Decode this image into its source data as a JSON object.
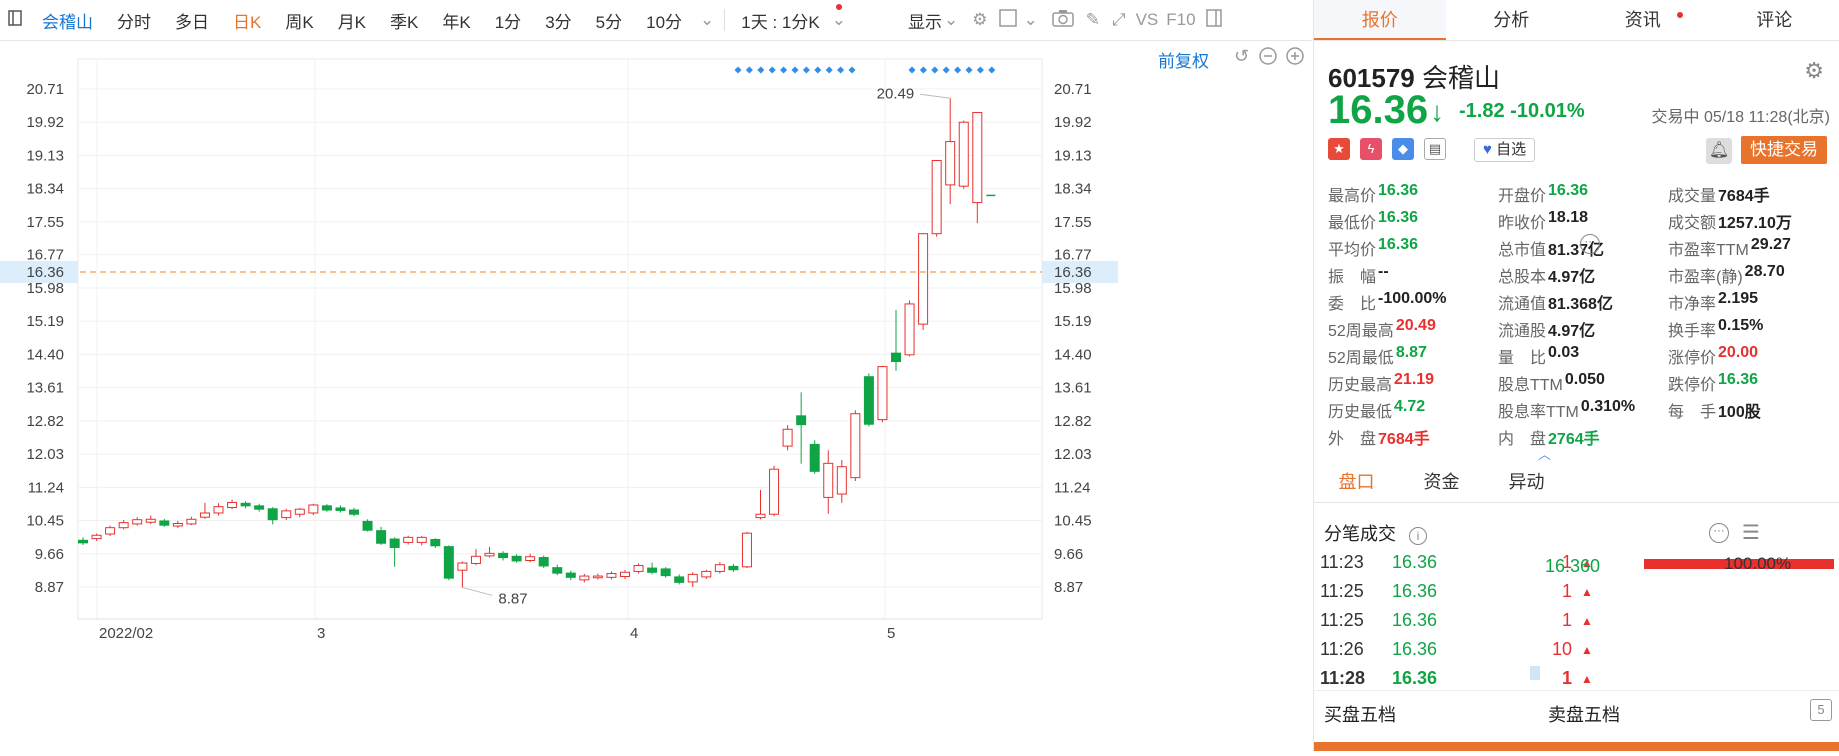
{
  "toolbar": {
    "stock_name": "会稽山",
    "periods": [
      "分时",
      "多日",
      "日K",
      "周K",
      "月K",
      "季K",
      "年K",
      "1分",
      "3分",
      "5分",
      "10分"
    ],
    "active_period": "日K",
    "interval_select": "1天 : 1分K",
    "display_label": "显示",
    "vs_label": "VS",
    "f10_label": "F10"
  },
  "chart_controls": {
    "adjust_label": "前复权"
  },
  "chart_data": {
    "type": "candlestick",
    "y_ticks": [
      "20.71",
      "19.92",
      "19.13",
      "18.34",
      "17.55",
      "16.77",
      "15.98",
      "15.19",
      "14.40",
      "13.61",
      "12.82",
      "12.03",
      "11.24",
      "10.45",
      "9.66",
      "8.87"
    ],
    "ylim": [
      8.87,
      20.71
    ],
    "x_labels": [
      "2022/02",
      "3",
      "4",
      "5"
    ],
    "current_price_line": "16.36",
    "high_annotation": "20.49",
    "low_annotation": "8.87",
    "up_color": "#e8302f",
    "down_color": "#0fa546",
    "candles": [
      {
        "o": 9.98,
        "c": 9.92,
        "h": 10.05,
        "l": 9.87
      },
      {
        "o": 10.02,
        "c": 10.1,
        "h": 10.14,
        "l": 9.97
      },
      {
        "o": 10.13,
        "c": 10.28,
        "h": 10.33,
        "l": 10.08
      },
      {
        "o": 10.28,
        "c": 10.4,
        "h": 10.46,
        "l": 10.24
      },
      {
        "o": 10.37,
        "c": 10.47,
        "h": 10.53,
        "l": 10.33
      },
      {
        "o": 10.41,
        "c": 10.48,
        "h": 10.57,
        "l": 10.36
      },
      {
        "o": 10.44,
        "c": 10.34,
        "h": 10.49,
        "l": 10.3
      },
      {
        "o": 10.32,
        "c": 10.38,
        "h": 10.44,
        "l": 10.27
      },
      {
        "o": 10.37,
        "c": 10.48,
        "h": 10.54,
        "l": 10.34
      },
      {
        "o": 10.53,
        "c": 10.63,
        "h": 10.87,
        "l": 10.49
      },
      {
        "o": 10.63,
        "c": 10.78,
        "h": 10.86,
        "l": 10.57
      },
      {
        "o": 10.76,
        "c": 10.88,
        "h": 10.95,
        "l": 10.72
      },
      {
        "o": 10.86,
        "c": 10.8,
        "h": 10.91,
        "l": 10.74
      },
      {
        "o": 10.8,
        "c": 10.72,
        "h": 10.85,
        "l": 10.66
      },
      {
        "o": 10.73,
        "c": 10.47,
        "h": 10.77,
        "l": 10.36
      },
      {
        "o": 10.52,
        "c": 10.68,
        "h": 10.73,
        "l": 10.46
      },
      {
        "o": 10.6,
        "c": 10.72,
        "h": 10.75,
        "l": 10.53
      },
      {
        "o": 10.63,
        "c": 10.82,
        "h": 10.85,
        "l": 10.58
      },
      {
        "o": 10.8,
        "c": 10.7,
        "h": 10.84,
        "l": 10.66
      },
      {
        "o": 10.75,
        "c": 10.69,
        "h": 10.81,
        "l": 10.64
      },
      {
        "o": 10.7,
        "c": 10.6,
        "h": 10.75,
        "l": 10.55
      },
      {
        "o": 10.43,
        "c": 10.22,
        "h": 10.48,
        "l": 10.19
      },
      {
        "o": 10.21,
        "c": 9.91,
        "h": 10.3,
        "l": 9.87
      },
      {
        "o": 10.01,
        "c": 9.81,
        "h": 10.05,
        "l": 9.35
      },
      {
        "o": 9.93,
        "c": 10.05,
        "h": 10.09,
        "l": 9.88
      },
      {
        "o": 9.93,
        "c": 10.05,
        "h": 10.08,
        "l": 9.86
      },
      {
        "o": 10.0,
        "c": 9.85,
        "h": 10.03,
        "l": 9.8
      },
      {
        "o": 9.83,
        "c": 9.08,
        "h": 9.86,
        "l": 9.03
      },
      {
        "o": 9.27,
        "c": 9.44,
        "h": 9.48,
        "l": 8.86
      },
      {
        "o": 9.43,
        "c": 9.6,
        "h": 9.77,
        "l": 9.39
      },
      {
        "o": 9.61,
        "c": 9.67,
        "h": 9.82,
        "l": 9.57
      },
      {
        "o": 9.67,
        "c": 9.57,
        "h": 9.72,
        "l": 9.5
      },
      {
        "o": 9.6,
        "c": 9.49,
        "h": 9.65,
        "l": 9.45
      },
      {
        "o": 9.5,
        "c": 9.59,
        "h": 9.66,
        "l": 9.46
      },
      {
        "o": 9.57,
        "c": 9.37,
        "h": 9.62,
        "l": 9.32
      },
      {
        "o": 9.33,
        "c": 9.2,
        "h": 9.4,
        "l": 9.15
      },
      {
        "o": 9.2,
        "c": 9.1,
        "h": 9.26,
        "l": 9.03
      },
      {
        "o": 9.04,
        "c": 9.13,
        "h": 9.18,
        "l": 8.98
      },
      {
        "o": 9.09,
        "c": 9.13,
        "h": 9.19,
        "l": 9.05
      },
      {
        "o": 9.1,
        "c": 9.19,
        "h": 9.24,
        "l": 9.05
      },
      {
        "o": 9.12,
        "c": 9.22,
        "h": 9.27,
        "l": 9.06
      },
      {
        "o": 9.24,
        "c": 9.38,
        "h": 9.43,
        "l": 9.19
      },
      {
        "o": 9.32,
        "c": 9.22,
        "h": 9.45,
        "l": 9.17
      },
      {
        "o": 9.3,
        "c": 9.14,
        "h": 9.34,
        "l": 9.09
      },
      {
        "o": 9.11,
        "c": 8.98,
        "h": 9.17,
        "l": 8.93
      },
      {
        "o": 8.99,
        "c": 9.17,
        "h": 9.22,
        "l": 8.87
      },
      {
        "o": 9.11,
        "c": 9.24,
        "h": 9.28,
        "l": 9.06
      },
      {
        "o": 9.24,
        "c": 9.4,
        "h": 9.46,
        "l": 9.19
      },
      {
        "o": 9.36,
        "c": 9.28,
        "h": 9.42,
        "l": 9.23
      },
      {
        "o": 9.35,
        "c": 10.15,
        "h": 10.18,
        "l": 9.32
      },
      {
        "o": 10.52,
        "c": 10.6,
        "h": 11.18,
        "l": 10.48
      },
      {
        "o": 10.6,
        "c": 11.67,
        "h": 11.75,
        "l": 10.55
      },
      {
        "o": 12.22,
        "c": 12.62,
        "h": 12.72,
        "l": 12.12
      },
      {
        "o": 12.94,
        "c": 12.73,
        "h": 13.5,
        "l": 11.8
      },
      {
        "o": 12.26,
        "c": 11.62,
        "h": 12.36,
        "l": 11.56
      },
      {
        "o": 11.0,
        "c": 11.81,
        "h": 12.12,
        "l": 10.61
      },
      {
        "o": 11.08,
        "c": 11.73,
        "h": 11.89,
        "l": 10.87
      },
      {
        "o": 11.47,
        "c": 12.99,
        "h": 13.07,
        "l": 11.39
      },
      {
        "o": 13.87,
        "c": 12.74,
        "h": 13.95,
        "l": 12.69
      },
      {
        "o": 12.85,
        "c": 14.11,
        "h": 14.13,
        "l": 12.79
      },
      {
        "o": 14.43,
        "c": 14.23,
        "h": 15.46,
        "l": 14.01
      },
      {
        "o": 14.39,
        "c": 15.6,
        "h": 15.68,
        "l": 14.35
      },
      {
        "o": 15.12,
        "c": 17.27,
        "h": 17.28,
        "l": 14.98
      },
      {
        "o": 17.27,
        "c": 19.01,
        "h": 19.02,
        "l": 17.2
      },
      {
        "o": 18.43,
        "c": 19.46,
        "h": 20.49,
        "l": 17.97
      },
      {
        "o": 18.4,
        "c": 19.92,
        "h": 19.96,
        "l": 18.34
      },
      {
        "o": 18.01,
        "c": 20.15,
        "h": 20.16,
        "l": 17.52
      },
      {
        "o": 18.18,
        "c": 18.18,
        "h": 18.18,
        "l": 18.18
      }
    ]
  },
  "quote": {
    "tabs": [
      "报价",
      "分析",
      "资讯",
      "评论"
    ],
    "code": "601579",
    "name": "会稽山",
    "price": "16.36",
    "change": "-1.82",
    "change_pct": "-10.01%",
    "status": "交易中 05/18 11:28(北京)",
    "watch_label": "自选",
    "quick_trade": "快捷交易",
    "fields": [
      [
        {
          "label": "最高价",
          "value": "16.36",
          "tone": "dn"
        },
        {
          "label": "开盘价",
          "value": "16.36",
          "tone": "dn"
        },
        {
          "label": "成交量",
          "value": "7684手",
          "tone": "blk"
        }
      ],
      [
        {
          "label": "最低价",
          "value": "16.36",
          "tone": "dn"
        },
        {
          "label": "昨收价",
          "value": "18.18",
          "tone": "blk"
        },
        {
          "label": "成交额",
          "value": "1257.10万",
          "tone": "blk"
        }
      ],
      [
        {
          "label": "平均价",
          "value": "16.36",
          "tone": "dn"
        },
        {
          "label": "总市值",
          "value": "81.37亿",
          "tone": "blk"
        },
        {
          "label": "市盈率TTM",
          "value": "29.27",
          "tone": "blk"
        }
      ],
      [
        {
          "label": "振　幅",
          "value": "--",
          "tone": "blk"
        },
        {
          "label": "总股本",
          "value": "4.97亿",
          "tone": "blk"
        },
        {
          "label": "市盈率(静)",
          "value": "28.70",
          "tone": "blk"
        }
      ],
      [
        {
          "label": "委　比",
          "value": "-100.00%",
          "tone": "blk"
        },
        {
          "label": "流通值",
          "value": "81.368亿",
          "tone": "blk"
        },
        {
          "label": "市净率",
          "value": "2.195",
          "tone": "blk"
        }
      ],
      [
        {
          "label": "52周最高",
          "value": "20.49",
          "tone": "up"
        },
        {
          "label": "流通股",
          "value": "4.97亿",
          "tone": "blk"
        },
        {
          "label": "换手率",
          "value": "0.15%",
          "tone": "blk"
        }
      ],
      [
        {
          "label": "52周最低",
          "value": "8.87",
          "tone": "dn"
        },
        {
          "label": "量　比",
          "value": "0.03",
          "tone": "blk"
        },
        {
          "label": "涨停价",
          "value": "20.00",
          "tone": "up"
        }
      ],
      [
        {
          "label": "历史最高",
          "value": "21.19",
          "tone": "up"
        },
        {
          "label": "股息TTM",
          "value": "0.050",
          "tone": "blk"
        },
        {
          "label": "跌停价",
          "value": "16.36",
          "tone": "dn"
        }
      ],
      [
        {
          "label": "历史最低",
          "value": "4.72",
          "tone": "dn"
        },
        {
          "label": "股息率TTM",
          "value": "0.310%",
          "tone": "blk"
        },
        {
          "label": "每　手",
          "value": "100股",
          "tone": "blk"
        }
      ],
      [
        {
          "label": "外　盘",
          "value": "7684手",
          "tone": "up"
        },
        {
          "label": "内　盘",
          "value": "2764手",
          "tone": "dn"
        },
        {
          "label": "",
          "value": "",
          "tone": "blk"
        }
      ]
    ]
  },
  "subtabs": [
    "盘口",
    "资金",
    "异动"
  ],
  "trades_title": "分笔成交",
  "trades": [
    {
      "time": "11:23",
      "price": "16.36",
      "qty": "1"
    },
    {
      "time": "11:25",
      "price": "16.36",
      "qty": "1"
    },
    {
      "time": "11:25",
      "price": "16.36",
      "qty": "1"
    },
    {
      "time": "11:26",
      "price": "16.36",
      "qty": "10"
    },
    {
      "time": "11:28",
      "price": "16.36",
      "qty": "1"
    }
  ],
  "price_dist": {
    "price": "16.360",
    "pct": "100.00%"
  },
  "bottom": {
    "buy": "买盘五档",
    "sell": "卖盘五档"
  }
}
